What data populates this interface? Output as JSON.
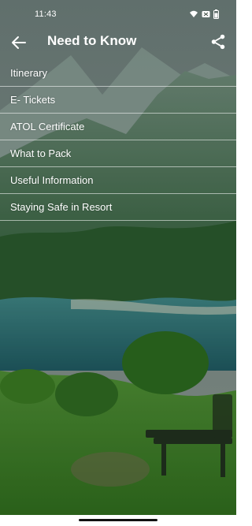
{
  "status_bar": {
    "time": "11:43",
    "icons": [
      "wifi-icon",
      "notification-icon",
      "battery-icon"
    ]
  },
  "app_bar": {
    "title": "Need to Know",
    "back_icon": "arrow-back-icon",
    "share_icon": "share-icon"
  },
  "menu": {
    "items": [
      {
        "label": "Itinerary"
      },
      {
        "label": "E- Tickets"
      },
      {
        "label": "ATOL Certificate"
      },
      {
        "label": "What to Pack"
      },
      {
        "label": "Useful Information"
      },
      {
        "label": "Staying Safe in Resort"
      }
    ]
  },
  "colors": {
    "sky": "#7e8f86",
    "mountain": "#4d6b56",
    "lake": "#2f6f74",
    "grass": "#3f8a2a"
  }
}
